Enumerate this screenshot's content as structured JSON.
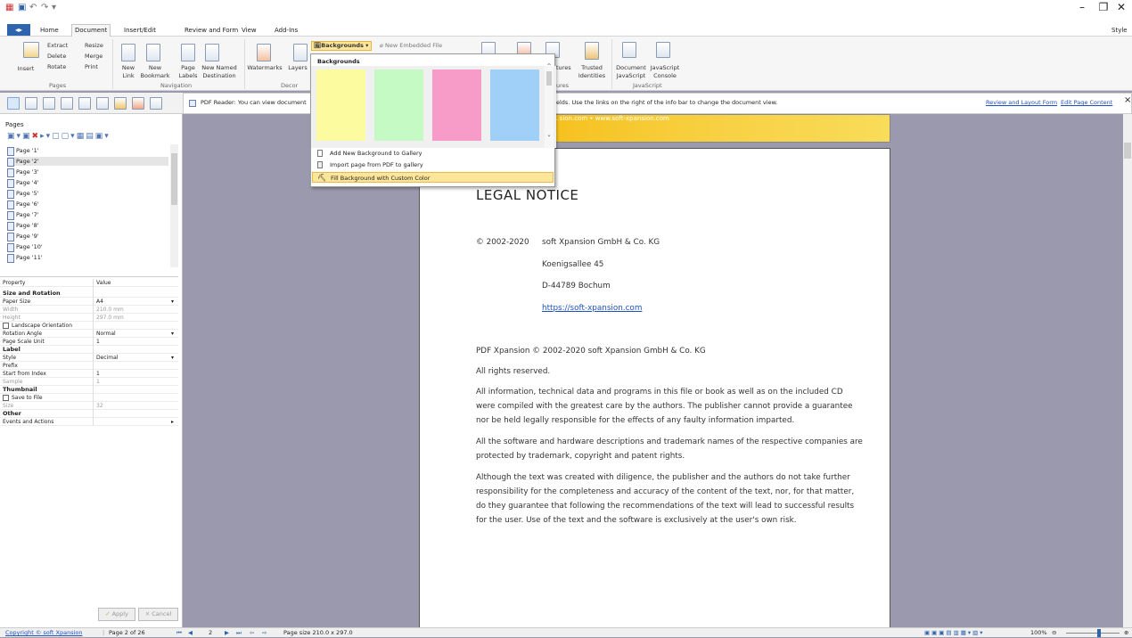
{
  "qat": {
    "icons": [
      "app-icon",
      "save-icon",
      "undo-icon",
      "redo-icon",
      "qat-menu-icon"
    ]
  },
  "window": {
    "minimize": "–",
    "restore": "❐",
    "close": "✕",
    "style": "Style"
  },
  "tabs": [
    "Home",
    "Document",
    "Insert/Edit",
    "Review and Form",
    "View",
    "Add-Ins"
  ],
  "ribbon": {
    "pages": {
      "extract": "Extract",
      "resize": "Resize",
      "delete": "Delete",
      "merge": "Merge",
      "insert": "Insert",
      "rotate": "Rotate",
      "print": "Print",
      "group": "Pages"
    },
    "navigation": {
      "new_link": [
        "New",
        "Link"
      ],
      "new_bookmark": [
        "New",
        "Bookmark"
      ],
      "page_labels": [
        "Page",
        "Labels"
      ],
      "new_named_destination": [
        "New Named",
        "Destination"
      ],
      "group": "Navigation"
    },
    "decoration": {
      "watermarks": "Watermarks",
      "layers": "Layers",
      "group": "Decor",
      "backgrounds": "Backgrounds",
      "new_embedded_file": "New Embedded File"
    },
    "signatures": {
      "tures": "tures",
      "ures": "ures"
    },
    "trusted": [
      "Trusted",
      "Identities"
    ],
    "javascript": {
      "document_js": [
        "Document",
        "JavaScript"
      ],
      "js_console": [
        "JavaScript",
        "Console"
      ],
      "group": "JavaScript"
    }
  },
  "infobar": {
    "text": "PDF Reader: You can view document",
    "text2": "elds. Use the links on the right of the info bar to change the document view.",
    "link1": "Review and Layout Form",
    "link2": "Edit Page Content",
    "close": "×"
  },
  "pages_panel": {
    "title": "Pages",
    "items": [
      "Page '1'",
      "Page '2'",
      "Page '3'",
      "Page '4'",
      "Page '5'",
      "Page '6'",
      "Page '7'",
      "Page '8'",
      "Page '9'",
      "Page '10'",
      "Page '11'"
    ]
  },
  "properties": {
    "header": {
      "property": "Property",
      "value": "Value"
    },
    "size_rotation": "Size and Rotation",
    "paper_size": {
      "k": "Paper Size",
      "v": "A4"
    },
    "width": {
      "k": "Width",
      "v": "210.0 mm"
    },
    "height": {
      "k": "Height",
      "v": "297.0 mm"
    },
    "landscape": "Landscape Orientation",
    "rotation": {
      "k": "Rotation Angle",
      "v": "Normal"
    },
    "scale": {
      "k": "Page Scale Unit",
      "v": "1"
    },
    "label": "Label",
    "style": {
      "k": "Style",
      "v": "Decimal"
    },
    "prefix": {
      "k": "Prefix",
      "v": ""
    },
    "start": {
      "k": "Start from Index",
      "v": "1"
    },
    "sample": {
      "k": "Sample",
      "v": "1"
    },
    "thumbnail": "Thumbnail",
    "save_to_file": "Save to File",
    "size": {
      "k": "Size",
      "v": "32"
    },
    "other": "Other",
    "events": {
      "k": "Events and Actions",
      "v": ""
    },
    "apply": "Apply",
    "cancel": "Cancel"
  },
  "dropdown": {
    "header": "Backgrounds",
    "swatches": [
      "#fdfba0",
      "#c5fac5",
      "#f79bc9",
      "#a0cff8"
    ],
    "items": [
      "Add New Background to Gallery",
      "Import page from PDF to gallery",
      "Fill Background with Custom Color"
    ]
  },
  "document": {
    "banner": "...sion.com • www.soft-xpansion.com",
    "heading": "LEGAL NOTICE",
    "copyright_years": "© 2002-2020",
    "company": "soft Xpansion GmbH & Co. KG",
    "street": "Koenigsallee 45",
    "city": "D-44789 Bochum",
    "url": "https://soft-xpansion.com",
    "p1": "PDF Xpansion © 2002-2020 soft Xpansion GmbH & Co. KG",
    "p2": "All rights reserved.",
    "p3": [
      "All information, technical data and programs in this file or book as well as on the included CD",
      "were compiled with the greatest care by the authors. The publisher cannot provide a guarantee",
      "nor be held legally responsible for the effects of any faulty information imparted."
    ],
    "p4": [
      "All the software and hardware descriptions and trademark names of the respective companies are",
      "protected by trademark, copyright and patent rights."
    ],
    "p5": [
      "Although the text was created with diligence, the publisher and the authors do not take further",
      "responsibility for the completeness and accuracy of the content of the text, nor, for that matter,",
      "do they guarantee that following the recommendations of the text will lead to successful results",
      "for the user. Use of the text and the software is exclusively at the user's own risk."
    ]
  },
  "status": {
    "copyright": "Copyright © soft Xpansion",
    "page_of": "Page 2 of 26",
    "page_num": "2",
    "page_size": "Page size 210.0 x 297.0",
    "zoom": "100%",
    "zoom_level": 0.62
  }
}
